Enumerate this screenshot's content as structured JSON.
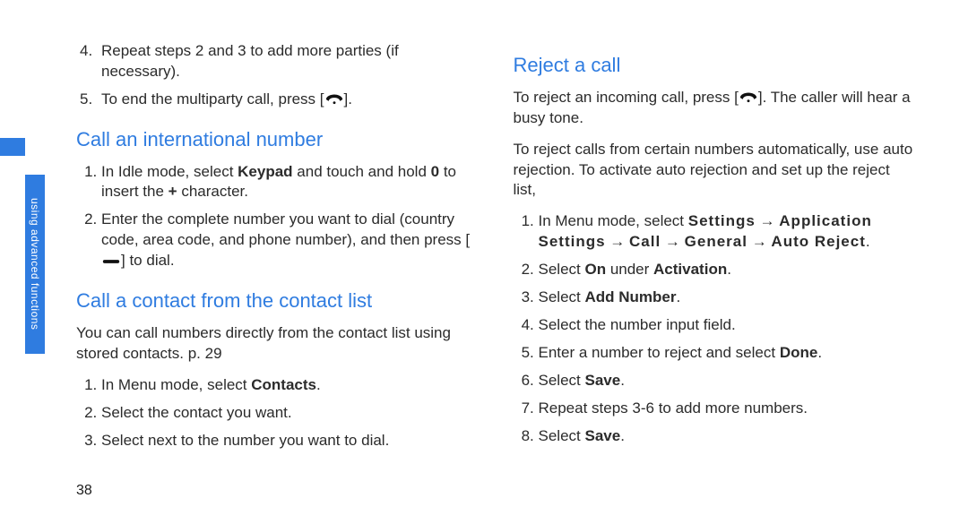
{
  "sideTab": "using advanced functions",
  "pageNumber": "38",
  "left": {
    "continuedSteps": [
      "Repeat steps 2 and 3 to add more parties (if necessary).",
      "To end the multiparty call, press [END_ICON]."
    ],
    "heading1": "Call an international number",
    "intlSteps": [
      {
        "pre": "In Idle mode, select ",
        "b1": "Keypad",
        "mid": " and touch and hold ",
        "b2": "0",
        "post": " to insert the ",
        "b3": "+",
        "tail": " character."
      },
      {
        "text": "Enter the complete number you want to dial (country code, area code, and phone number), and then press [DIAL_ICON] to dial."
      }
    ],
    "heading2": "Call a contact from the contact list",
    "contactIntro": "You can call numbers directly from the contact list using stored contacts.    p. 29",
    "contactSteps": [
      {
        "pre": "In Menu mode, select ",
        "b1": "Contacts",
        "post": "."
      },
      {
        "text": "Select the contact you want."
      },
      {
        "text": "Select      next to the number you want to dial."
      }
    ]
  },
  "right": {
    "heading": "Reject a call",
    "para1": "To reject an incoming call, press [END_ICON]. The caller will hear a busy tone.",
    "para2": "To reject calls from certain numbers automatically, use auto rejection. To activate auto rejection and set up the reject list,",
    "steps": [
      {
        "pre": "In Menu mode, select ",
        "b": "Settings → Application Settings → Call → General → Auto Reject",
        "post": "."
      },
      {
        "pre": "Select ",
        "b": "On",
        "mid": " under ",
        "b2": "Activation",
        "post": "."
      },
      {
        "pre": "Select ",
        "b": "Add Number",
        "post": "."
      },
      {
        "text": "Select the number input field."
      },
      {
        "pre": "Enter a number to reject and select ",
        "b": "Done",
        "post": "."
      },
      {
        "pre": "Select ",
        "b": "Save",
        "post": "."
      },
      {
        "text": "Repeat steps 3-6 to add more numbers."
      },
      {
        "pre": "Select ",
        "b": "Save",
        "post": "."
      }
    ]
  }
}
